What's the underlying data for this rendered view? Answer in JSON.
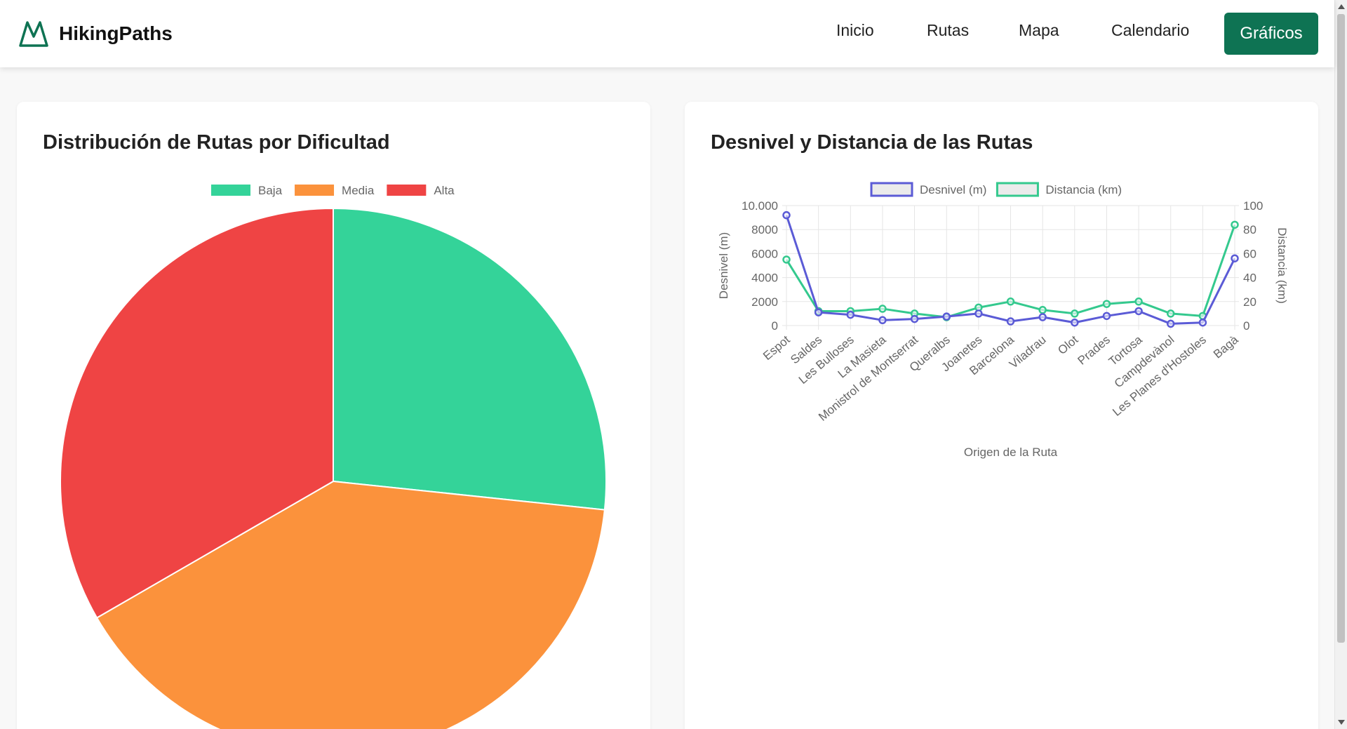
{
  "app": {
    "brand": "HikingPaths",
    "accent": "#0e7353"
  },
  "nav": {
    "items": [
      {
        "label": "Inicio"
      },
      {
        "label": "Rutas"
      },
      {
        "label": "Mapa"
      },
      {
        "label": "Calendario"
      }
    ],
    "active_label": "Gráficos"
  },
  "cards": {
    "pie_title": "Distribución de Rutas por Dificultad",
    "line_title": "Desnivel y Distancia de las Rutas"
  },
  "chart_data": [
    {
      "type": "pie",
      "categories": [
        "Baja",
        "Media",
        "Alta"
      ],
      "values": [
        4,
        6,
        5
      ],
      "colors": [
        "#34d399",
        "#fb923c",
        "#ef4444"
      ],
      "legend": "top-center"
    },
    {
      "type": "line",
      "xlabel": "Origen de la Ruta",
      "categories": [
        "Espot",
        "Saldes",
        "Les Bulloses",
        "La Masieta",
        "Monistrol de Montserrat",
        "Queralbs",
        "Joanetes",
        "Barcelona",
        "Viladrau",
        "Olot",
        "Prades",
        "Tortosa",
        "Campdevànol",
        "Les Planes d'Hostoles",
        "Bagà"
      ],
      "series": [
        {
          "name": "Desnivel (m)",
          "axis": "left",
          "color": "#5b5bd6",
          "values": [
            9200,
            1100,
            900,
            450,
            550,
            750,
            1000,
            350,
            700,
            250,
            800,
            1200,
            150,
            250,
            5600
          ]
        },
        {
          "name": "Distancia (km)",
          "axis": "right",
          "color": "#34c98e",
          "values": [
            55,
            12,
            12,
            14,
            10,
            7,
            15,
            20,
            13,
            10,
            18,
            20,
            10,
            8,
            84
          ]
        }
      ],
      "y_left": {
        "label": "Desnivel (m)",
        "range": [
          0,
          10000
        ],
        "ticks": [
          "0",
          "2000",
          "4000",
          "6000",
          "8000",
          "10.000"
        ]
      },
      "y_right": {
        "label": "Distancia (km)",
        "range": [
          0,
          100
        ],
        "ticks": [
          "0",
          "20",
          "40",
          "60",
          "80",
          "100"
        ]
      },
      "grid": true,
      "legend": "top-center"
    }
  ]
}
